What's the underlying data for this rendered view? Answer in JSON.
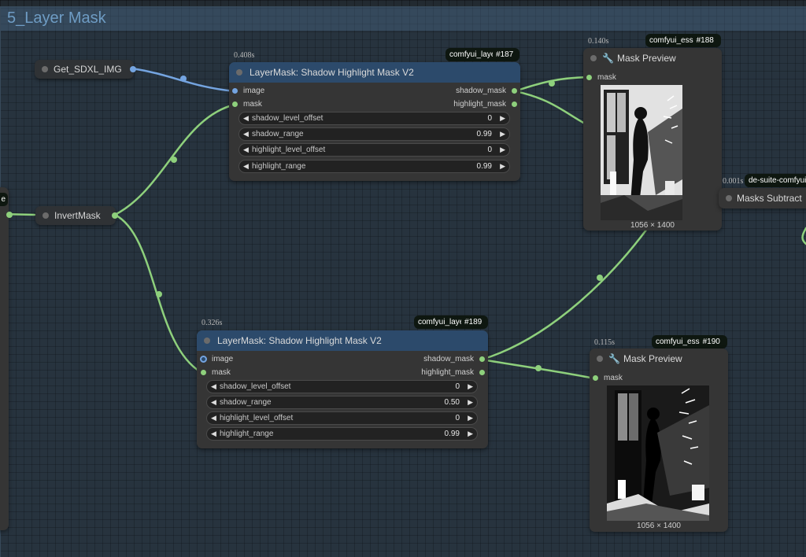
{
  "group": {
    "title": "5_Layer Mask"
  },
  "left_node": {
    "label": "e"
  },
  "get_node": {
    "label": "Get_SDXL_IMG"
  },
  "invert_node": {
    "label": "InvertMask"
  },
  "node187": {
    "time": "0.408s",
    "badge_source": "comfyui_laye",
    "badge_id": "#187",
    "title": "LayerMask: Shadow Highlight Mask V2",
    "inputs": [
      "image",
      "mask"
    ],
    "outputs": [
      "shadow_mask",
      "highlight_mask"
    ],
    "widgets": [
      {
        "name": "shadow_level_offset",
        "value": "0"
      },
      {
        "name": "shadow_range",
        "value": "0.99"
      },
      {
        "name": "highlight_level_offset",
        "value": "0"
      },
      {
        "name": "highlight_range",
        "value": "0.99"
      }
    ]
  },
  "node189": {
    "time": "0.326s",
    "badge_source": "comfyui_laye",
    "badge_id": "#189",
    "title": "LayerMask: Shadow Highlight Mask V2",
    "inputs": [
      "image",
      "mask"
    ],
    "outputs": [
      "shadow_mask",
      "highlight_mask"
    ],
    "widgets": [
      {
        "name": "shadow_level_offset",
        "value": "0"
      },
      {
        "name": "shadow_range",
        "value": "0.50"
      },
      {
        "name": "highlight_level_offset",
        "value": "0"
      },
      {
        "name": "highlight_range",
        "value": "0.99"
      }
    ]
  },
  "node188": {
    "time": "0.140s",
    "badge_source": "comfyui_ess",
    "badge_id": "#188",
    "title": "Mask Preview",
    "input": "mask",
    "dims": "1056 × 1400"
  },
  "node190": {
    "time": "0.115s",
    "badge_source": "comfyui_ess",
    "badge_id": "#190",
    "title": "Mask Preview",
    "input": "mask",
    "dims": "1056 × 1400"
  },
  "subtract_node": {
    "time": "0.001s",
    "badge_source": "de-suite-comfyui",
    "title": "Masks Subtract"
  },
  "icons": {
    "arrow_left": "◀",
    "arrow_right": "▶",
    "wrench": "🔧"
  },
  "colors": {
    "mask_wire": "#8ed07c",
    "image_wire": "#74a4e0",
    "node_title_blue": "#2c4a6b"
  }
}
